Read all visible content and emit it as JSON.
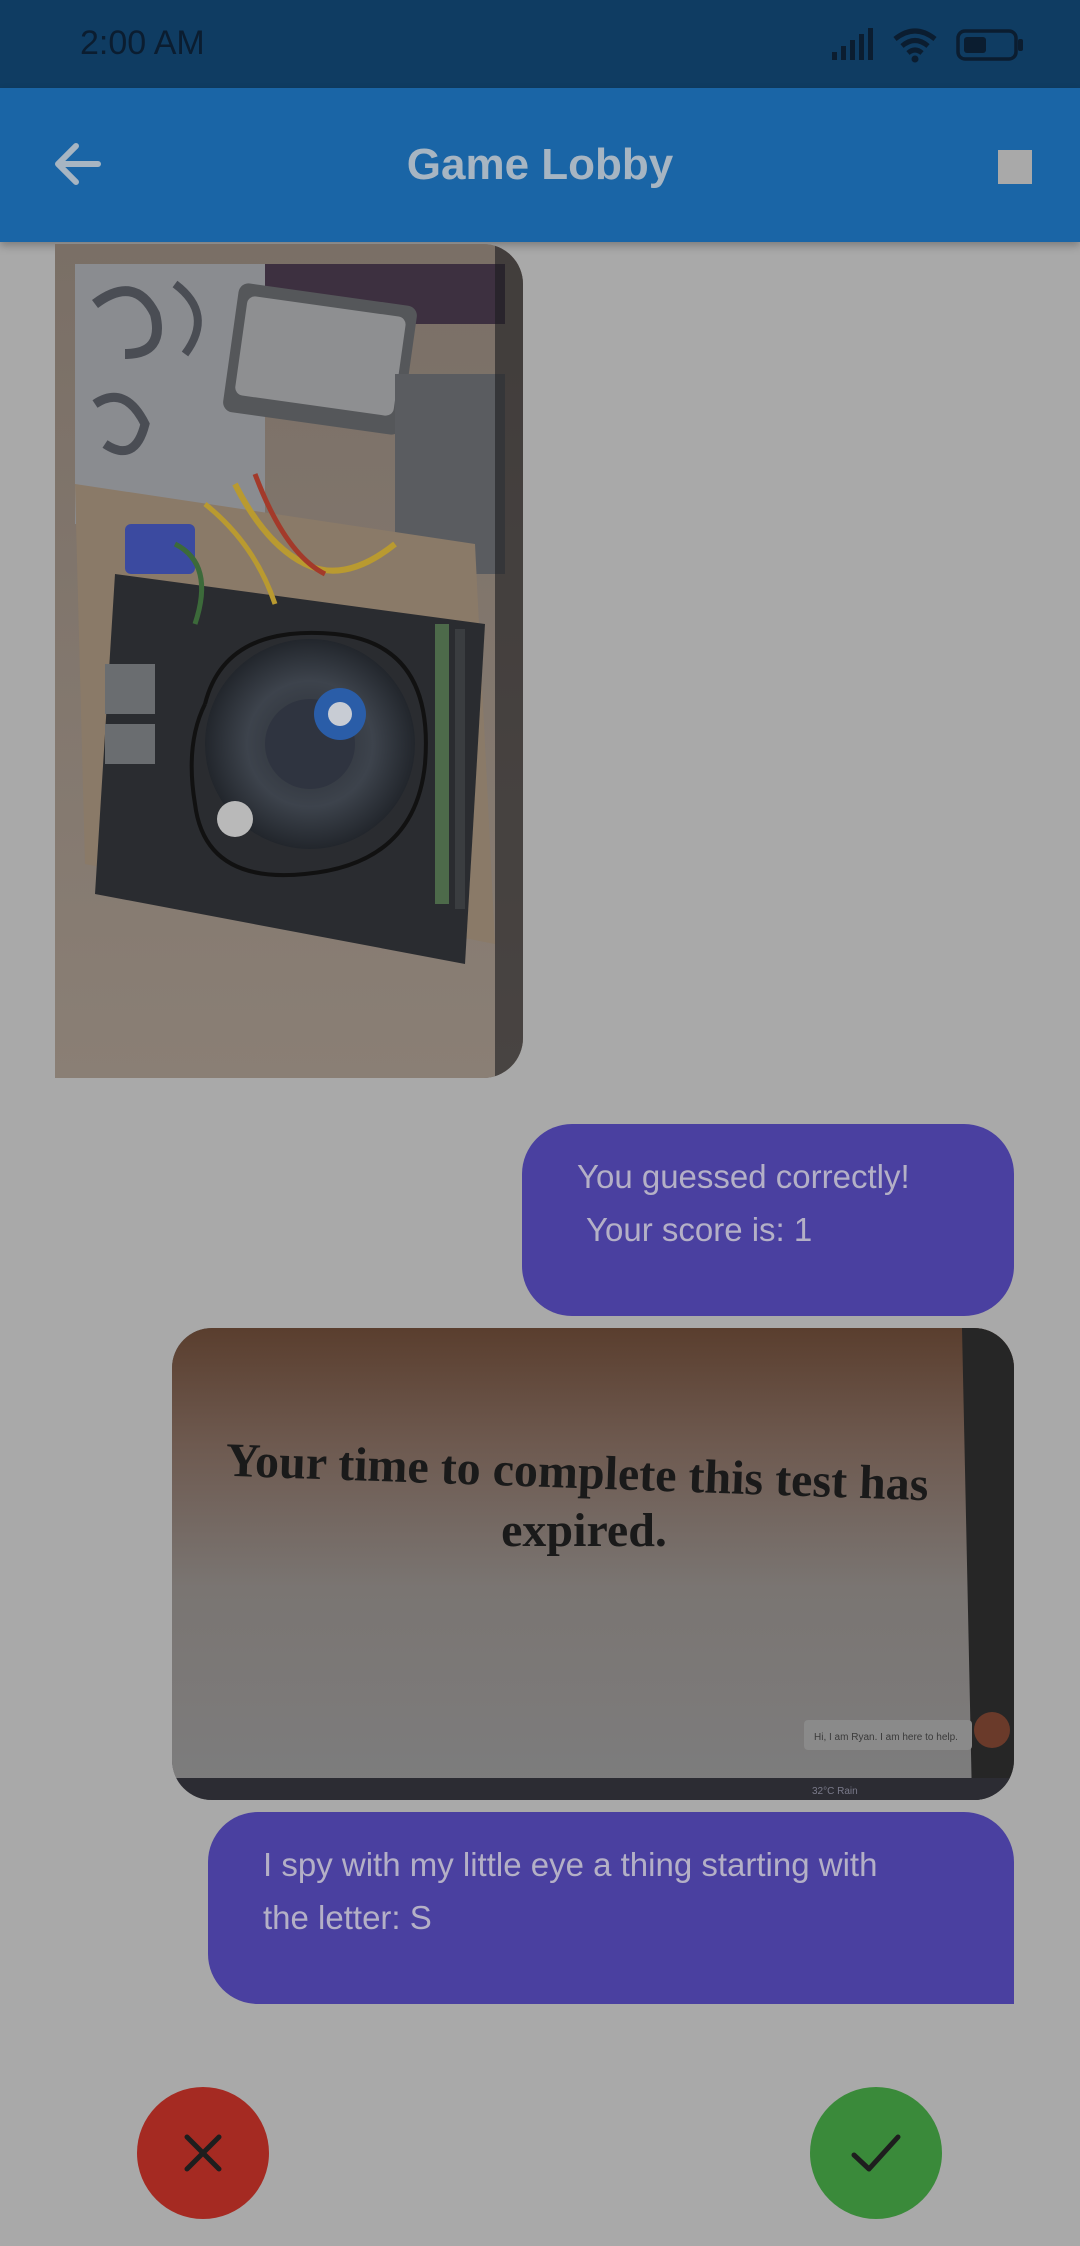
{
  "status_bar": {
    "time": "2:00 AM",
    "icons": [
      "signal-icon",
      "wifi-icon",
      "battery-icon"
    ]
  },
  "app_bar": {
    "title": "Game Lobby",
    "back_icon": "arrow-left-icon",
    "action_icon": "stop-icon"
  },
  "messages": {
    "image1_content": "photo of computer motherboard with CPU fan circled",
    "result": {
      "line1": "You guessed correctly!",
      "line2": "Your score is: 1"
    },
    "image2": {
      "line1": "Your time to complete this test has",
      "line2": "expired.",
      "chat_popup": "Hi, I am Ryan. I am here to help.",
      "taskbar_text": "32°C  Rain"
    },
    "prompt": {
      "line1": "I spy with my little eye a thing starting with",
      "line2": "the letter: S"
    }
  },
  "actions": {
    "reject_icon": "close-icon",
    "accept_icon": "check-icon",
    "reject_color": "#a52a22",
    "accept_color": "#3a8a3a"
  }
}
